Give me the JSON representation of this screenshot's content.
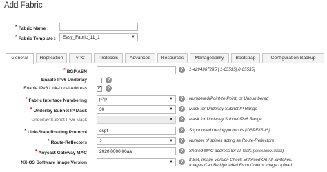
{
  "dialog": {
    "title": "Add Fabric"
  },
  "top_fields": {
    "fabric_name": {
      "label": "Fabric Name :",
      "value": ""
    },
    "fabric_template": {
      "label": "Fabric Template :",
      "value": "Easy_Fabric_11_1"
    }
  },
  "tabs": [
    "General",
    "Replication",
    "vPC",
    "Protocols",
    "Advanced",
    "Resources",
    "Manageability",
    "Bootstrap",
    "Configuration Backup"
  ],
  "active_tab": "General",
  "general": {
    "bgp_asn": {
      "label": "BGP ASN",
      "value": "",
      "hint": "1-4294967295 | 1-65535[.0-65535]"
    },
    "enable_ipv6_underlay": {
      "label": "Enable IPv6 Underlay",
      "checked": false
    },
    "enable_ipv6_link_local": {
      "label": "Enable IPv6 Link-Local Address",
      "checked": true
    },
    "fabric_interface_numbering": {
      "label": "Fabric Interface Numbering",
      "value": "p2p",
      "hint": "Numbered(Point-to-Point) or Unnumbered"
    },
    "underlay_subnet_ip_mask": {
      "label": "Underlay Subnet IP Mask",
      "value": "30",
      "hint": "Mask for Underlay Subnet IP Range"
    },
    "underlay_subnet_ipv6_mask": {
      "label": "Underlay Subnet IPv6 Mask",
      "value": "",
      "hint": "Mask for Underlay Subnet IPv6 Range"
    },
    "link_state_routing_protocol": {
      "label": "Link-State Routing Protocol",
      "value": "ospf",
      "hint": "Suppported routing protocols (OSPF/IS-IS)"
    },
    "route_reflectors": {
      "label": "Route-Reflectors",
      "value": "2",
      "hint": "Number of spines acting as Route-Reflectors"
    },
    "anycast_gateway_mac": {
      "label": "Anycast Gateway MAC",
      "value": "2020.0000.00aa",
      "hint": "Shared MAC address for all leafs (xxxx.xxxx.xxxx)"
    },
    "nxos_software_image_version": {
      "label": "NX-OS Software Image Version",
      "value": "",
      "hint_line1": "If Set, Image Version Check Enforced On All Switches.",
      "hint_line2": "Images Can Be Uploaded From Control:Image Upload"
    }
  },
  "required_mark": "*",
  "help_glyph": "?",
  "caret_glyph": "▼"
}
